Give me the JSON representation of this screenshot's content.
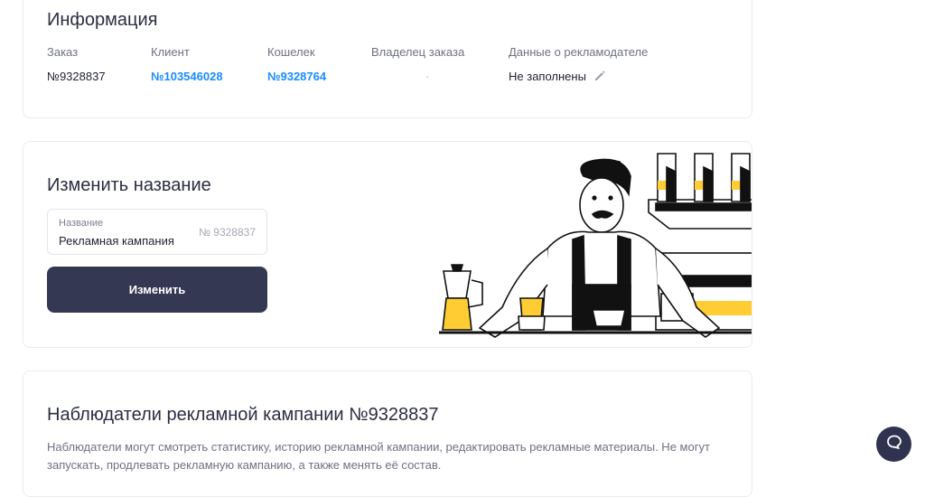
{
  "info": {
    "title": "Информация",
    "columns": [
      {
        "label": "Заказ",
        "value": "№9328837"
      },
      {
        "label": "Клиент",
        "value": "№103546028"
      },
      {
        "label": "Кошелек",
        "value": "№9328764"
      },
      {
        "label": "Владелец заказа",
        "value": "·"
      },
      {
        "label": "Данные о рекламодателе",
        "value": "Не заполнены"
      }
    ]
  },
  "rename": {
    "title": "Изменить название",
    "field_label": "Название",
    "field_value": "Рекламная кампания",
    "field_placeholder": "№ 9328837",
    "button_label": "Изменить"
  },
  "watchers": {
    "title": "Наблюдатели рекламной кампании №9328837",
    "description": "Наблюдатели могут смотреть статистику, историю рекламной кампании, редактировать рекламные материалы. Не могут запускать, продлевать рекламную кампанию, а также менять её состав."
  },
  "colors": {
    "link": "#1a8cff",
    "button": "#353853",
    "accent_yellow": "#ffcc33"
  },
  "icons": {
    "edit": "pencil-icon",
    "chat": "chat-icon"
  }
}
